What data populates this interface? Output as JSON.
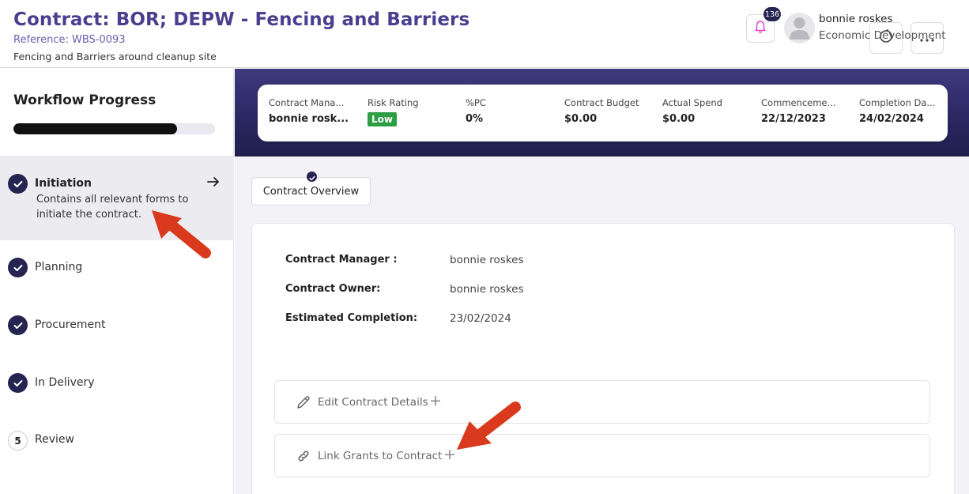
{
  "header": {
    "title": "Contract: BOR; DEPW - Fencing and Barriers",
    "reference": "Reference: WBS-0093",
    "description": "Fencing and Barriers around cleanup site",
    "notification_count": "136",
    "user_name": "bonnie roskes",
    "user_department": "Economic Development"
  },
  "sidebar": {
    "title": "Workflow Progress",
    "progress_fraction": 0.81,
    "steps": [
      {
        "label": "Initiation",
        "description": "Contains all relevant forms to initiate the contract.",
        "status": "complete",
        "active": true
      },
      {
        "label": "Planning",
        "status": "complete"
      },
      {
        "label": "Procurement",
        "status": "complete"
      },
      {
        "label": "In Delivery",
        "status": "complete"
      },
      {
        "label": "Review",
        "number": "5",
        "status": "pending"
      }
    ]
  },
  "summary": {
    "contract_manager_label": "Contract Mana...",
    "contract_manager_value": "bonnie rosk...",
    "risk_rating_label": "Risk Rating",
    "risk_rating_value": "Low",
    "pc_label": "%PC",
    "pc_value": "0%",
    "budget_label": "Contract Budget",
    "budget_value": "$0.00",
    "spend_label": "Actual Spend",
    "spend_value": "$0.00",
    "commencement_label": "Commenceme...",
    "commencement_value": "22/12/2023",
    "completion_label": "Completion Da...",
    "completion_value": "24/02/2024"
  },
  "tabs": {
    "overview_label": "Contract Overview"
  },
  "overview": {
    "manager_label": "Contract Manager :",
    "manager_value": "bonnie roskes",
    "owner_label": "Contract Owner:",
    "owner_value": "bonnie roskes",
    "completion_label": "Estimated Completion:",
    "completion_value": "23/02/2024"
  },
  "actions": {
    "edit_label": "Edit Contract Details",
    "link_label": "Link Grants to Contract",
    "plus": "+"
  },
  "colors": {
    "brand": "#4a3f8f",
    "navy": "#262450",
    "risk_low": "#2e9e44",
    "annotation_arrow": "#d93a1e"
  },
  "icons": [
    "bell-icon",
    "user-avatar-icon",
    "refresh-icon",
    "more-icon",
    "check-icon",
    "arrow-right-icon",
    "pencil-icon",
    "link-icon"
  ]
}
